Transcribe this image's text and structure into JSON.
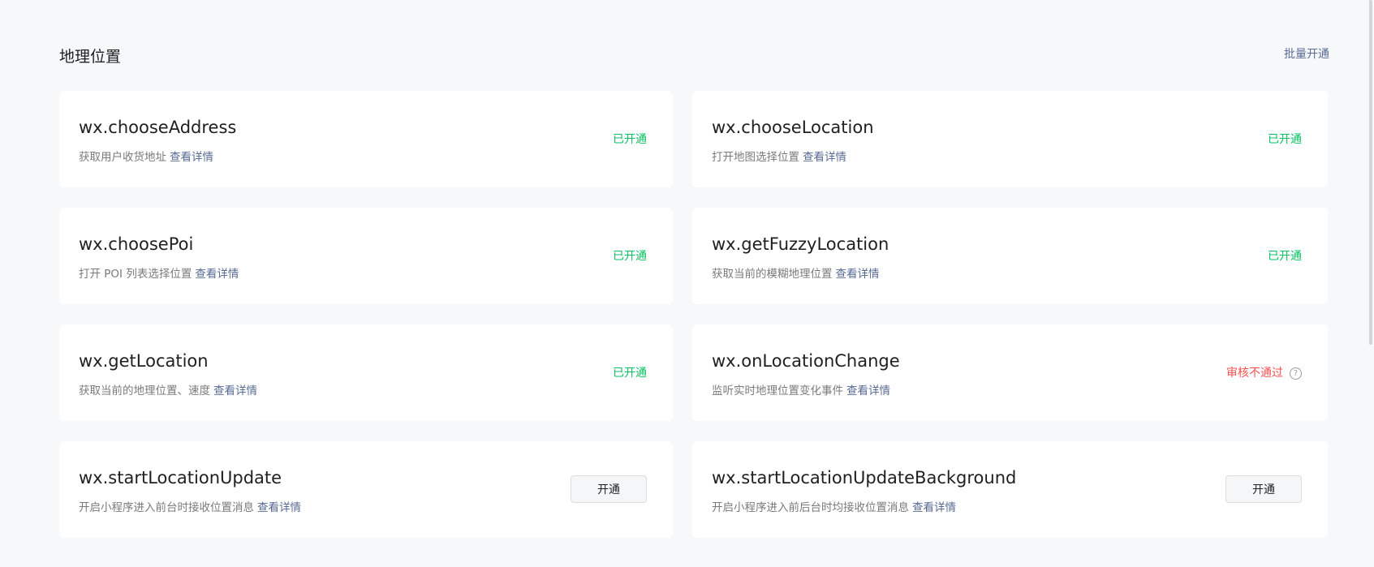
{
  "section": {
    "title": "地理位置",
    "batch_label": "批量开通"
  },
  "detail_label": "查看详情",
  "enable_label": "开通",
  "status_colors": {
    "ok": "#07c160",
    "fail": "#fa5151",
    "link": "#576b95"
  },
  "apis": [
    {
      "name": "wx.chooseAddress",
      "desc": "获取用户收货地址",
      "status": "已开通"
    },
    {
      "name": "wx.chooseLocation",
      "desc": "打开地图选择位置",
      "status": "已开通"
    },
    {
      "name": "wx.choosePoi",
      "desc": "打开 POI 列表选择位置",
      "status": "已开通"
    },
    {
      "name": "wx.getFuzzyLocation",
      "desc": "获取当前的模糊地理位置",
      "status": "已开通"
    },
    {
      "name": "wx.getLocation",
      "desc": "获取当前的地理位置、速度",
      "status": "已开通"
    },
    {
      "name": "wx.onLocationChange",
      "desc": "监听实时地理位置变化事件",
      "status": "审核不通过",
      "status_icon": "question-circle-icon"
    },
    {
      "name": "wx.startLocationUpdate",
      "desc": "开启小程序进入前台时接收位置消息",
      "status": ""
    },
    {
      "name": "wx.startLocationUpdateBackground",
      "desc": "开启小程序进入前后台时均接收位置消息",
      "status": ""
    }
  ]
}
